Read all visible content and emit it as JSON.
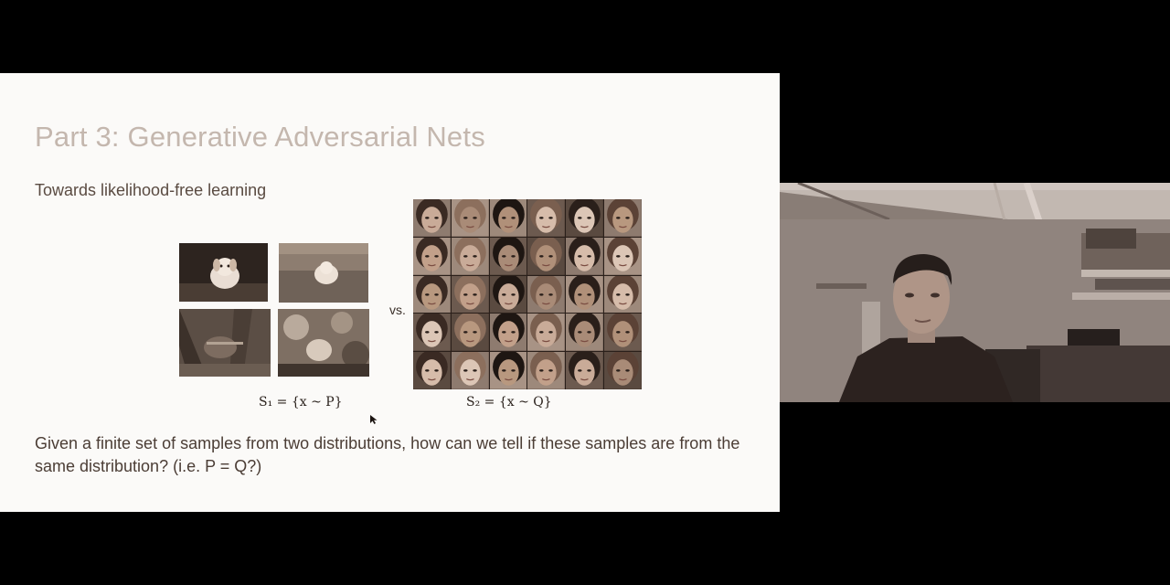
{
  "slide": {
    "title": "Part 3: Generative Adversarial Nets",
    "subtitle": "Towards likelihood-free learning",
    "vs": "vs.",
    "s1_label": "S₁ = {x ~ P}",
    "s2_label": "S₂ = {x ~ Q}",
    "question": "Given a finite set of samples from two distributions, how can we tell if these samples are from the same distribution? (i.e. P = Q?)"
  },
  "images": {
    "dog_photos": [
      "dog-photo-1",
      "dog-photo-2",
      "dog-photo-3",
      "dog-photo-4"
    ],
    "face_grid": {
      "rows": 5,
      "cols": 6
    }
  },
  "webcam": {
    "description_icon": "presenter-video-icon"
  }
}
